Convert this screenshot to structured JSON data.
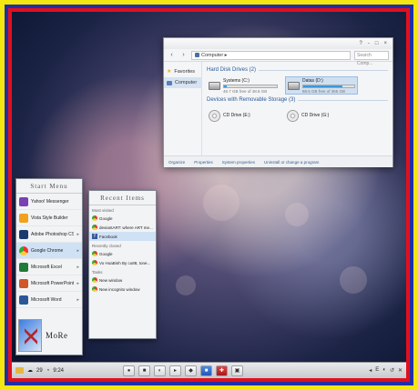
{
  "explorer": {
    "title_buttons": [
      "?",
      "-",
      "□",
      "×"
    ],
    "back_icon": "chevron-left-icon",
    "forward_icon": "chevron-right-icon",
    "address": "Computer ▸",
    "search_placeholder": "Search Comp...",
    "sidebar": [
      {
        "label": "Favorites",
        "icon": "star-icon"
      },
      {
        "label": "Computer",
        "icon": "computer-icon"
      }
    ],
    "hard_disk_heading": "Hard Disk Drives (2)",
    "drives": [
      {
        "name": "Systems (C:)",
        "free_text": "46.7 GB free of 48.8 GB",
        "used_fraction": 0.05
      },
      {
        "name": "Datas (D:)",
        "free_text": "88.5 GB free of 365 GB",
        "used_fraction": 0.76
      }
    ],
    "removable_heading": "Devices with Removable Storage (3)",
    "cd_drives": [
      {
        "name": "CD Drive (E:)"
      },
      {
        "name": "CD Drive (G:)"
      }
    ],
    "status_items": [
      "Organize",
      "Properties",
      "System properties",
      "Uninstall or change a program"
    ]
  },
  "start_menu": {
    "title": "Start Menu",
    "apps": [
      {
        "label": "Yahoo! Messenger",
        "color": "#7b3fb3",
        "arrow": ""
      },
      {
        "label": "Vista Style Builder",
        "color": "#f0a21e",
        "arrow": ""
      },
      {
        "label": "Adobe Photoshop CS4",
        "color": "#1b3b6e",
        "arrow": "▸"
      },
      {
        "label": "Google Chrome",
        "color": "#3cb043",
        "arrow": "▸"
      },
      {
        "label": "Microsoft Excel",
        "color": "#1f7a3a",
        "arrow": "▸"
      },
      {
        "label": "Microsoft PowerPoint",
        "color": "#d0572a",
        "arrow": "▸"
      },
      {
        "label": "Microsoft Word",
        "color": "#2b5797",
        "arrow": "▸"
      }
    ],
    "more_label": "MoRe"
  },
  "recent_items": {
    "title": "Recent Items",
    "most_visited_heading": "Most visited",
    "most_visited": [
      {
        "label": "Google",
        "icon": "chrome-icon"
      },
      {
        "label": "deviantART: where ART me...",
        "icon": "chrome-icon"
      },
      {
        "label": "Facebook",
        "icon": "facebook-icon"
      }
    ],
    "recently_closed_heading": "Recently closed",
    "recently_closed": [
      {
        "label": "Google",
        "icon": "chrome-icon"
      },
      {
        "label": "Vo HoaBinh By cu88, tone...",
        "icon": "chrome-icon"
      }
    ],
    "tasks_heading": "Tasks",
    "tasks": [
      {
        "label": "New window",
        "icon": "chrome-icon"
      },
      {
        "label": "New incognito window",
        "icon": "chrome-icon"
      }
    ]
  },
  "taskbar": {
    "temp": "29",
    "time": "9:24",
    "center_buttons": [
      "●",
      "■",
      "◐",
      "▸",
      "◆",
      "■",
      "✚",
      "▣"
    ],
    "tray": [
      "◂",
      "E",
      "◐",
      "↺",
      "✕"
    ]
  }
}
